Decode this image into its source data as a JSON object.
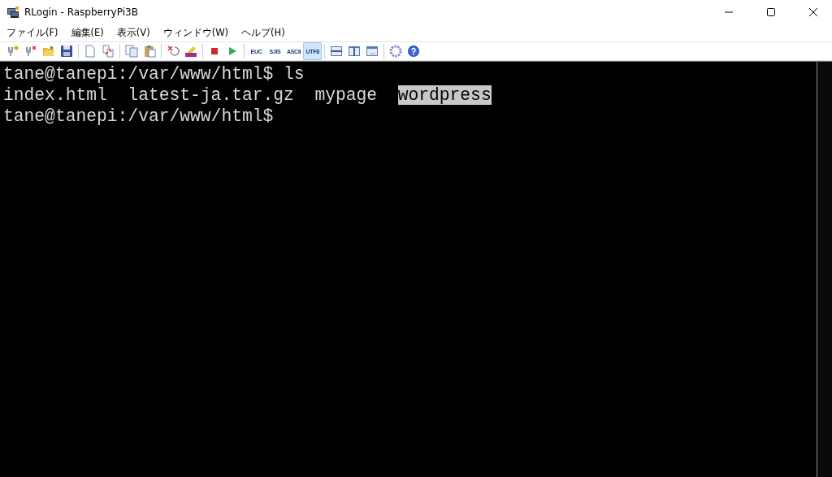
{
  "window": {
    "title": "RLogin - RaspberryPi3B"
  },
  "menu": [
    {
      "label": "ファイル(F)"
    },
    {
      "label": "編集(E)"
    },
    {
      "label": "表示(V)"
    },
    {
      "label": "ウィンドウ(W)"
    },
    {
      "label": "ヘルプ(H)"
    }
  ],
  "toolbar": [
    {
      "kind": "plug-add"
    },
    {
      "kind": "plug-remove"
    },
    {
      "kind": "folder"
    },
    {
      "kind": "disk"
    },
    {
      "kind": "sep"
    },
    {
      "kind": "page"
    },
    {
      "kind": "page-swap"
    },
    {
      "kind": "sep"
    },
    {
      "kind": "copy"
    },
    {
      "kind": "paste"
    },
    {
      "kind": "sep"
    },
    {
      "kind": "cancel"
    },
    {
      "kind": "abc"
    },
    {
      "kind": "sep"
    },
    {
      "kind": "stop"
    },
    {
      "kind": "play"
    },
    {
      "kind": "sep"
    },
    {
      "kind": "text",
      "label": "EUC",
      "selected": false
    },
    {
      "kind": "text",
      "label": "SJIS",
      "selected": false
    },
    {
      "kind": "text",
      "label": "ASCII",
      "selected": false
    },
    {
      "kind": "text",
      "label": "UTF8",
      "selected": true
    },
    {
      "kind": "sep"
    },
    {
      "kind": "split-h"
    },
    {
      "kind": "split-v"
    },
    {
      "kind": "split-dots"
    },
    {
      "kind": "sep"
    },
    {
      "kind": "gear"
    },
    {
      "kind": "help"
    }
  ],
  "terminal": {
    "lines": [
      [
        {
          "text": "tane@tanepi:/var/www/html$ ls",
          "highlighted": false
        }
      ],
      [
        {
          "text": "index.html  latest-ja.tar.gz  mypage  ",
          "highlighted": false
        },
        {
          "text": "wordpress",
          "highlighted": true
        }
      ],
      [
        {
          "text": "tane@tanepi:/var/www/html$",
          "highlighted": false
        }
      ]
    ]
  }
}
